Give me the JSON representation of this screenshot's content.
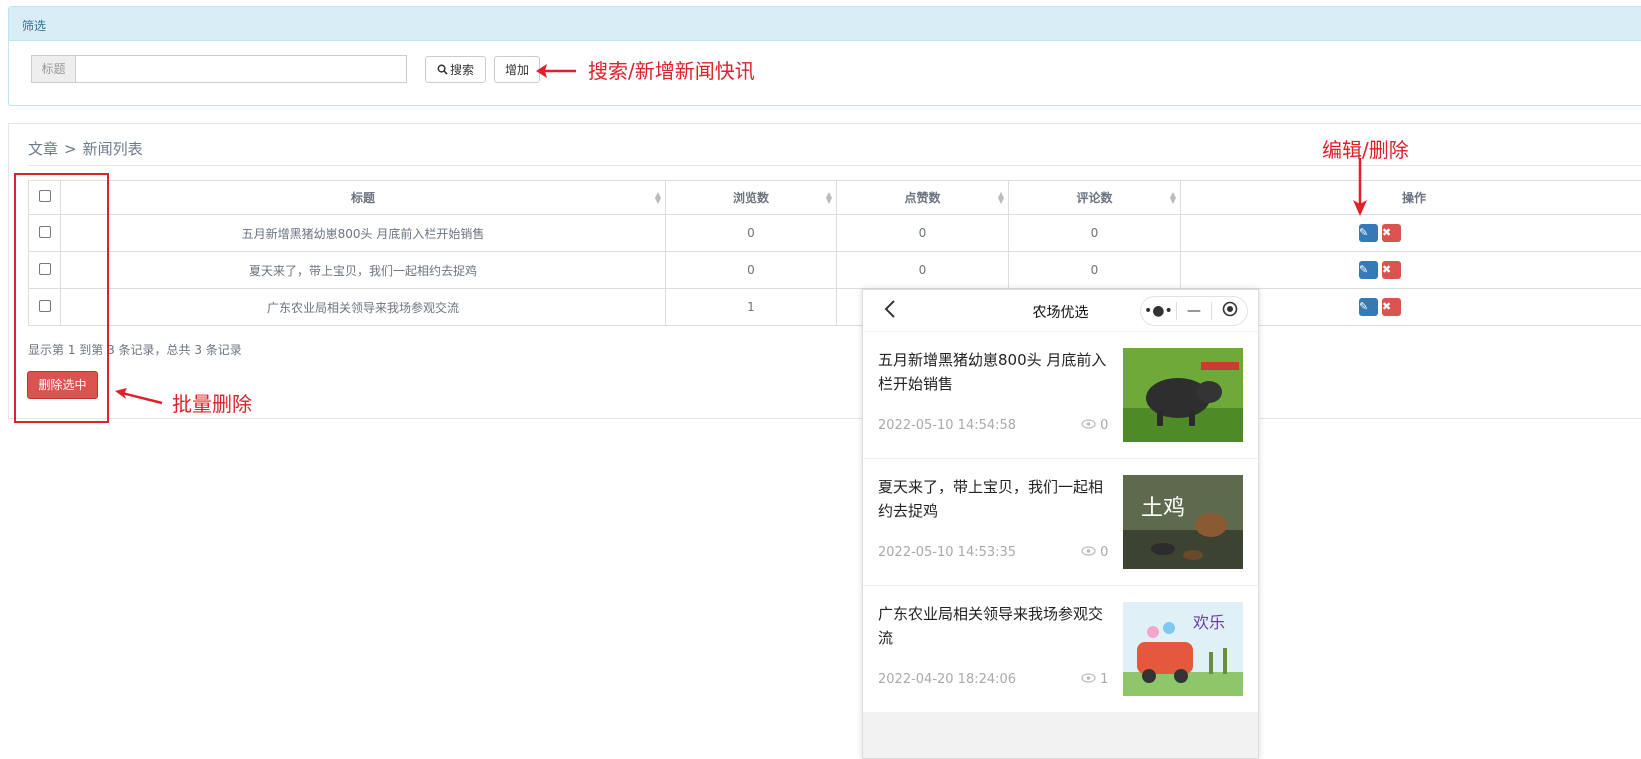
{
  "filter": {
    "header": "筛选",
    "title_label": "标题",
    "search_button": "搜索",
    "add_button": "增加",
    "annotation": "搜索/新增新闻快讯"
  },
  "breadcrumb": {
    "root": "文章",
    "separator": ">",
    "current": "新闻列表"
  },
  "annotations": {
    "edit_delete": "编辑/删除",
    "batch_delete": "批量删除"
  },
  "table": {
    "headers": [
      "标题",
      "浏览数",
      "点赞数",
      "评论数",
      "操作"
    ],
    "rows": [
      {
        "title": "五月新增黑猪幼崽800头 月底前入栏开始销售",
        "views": "0",
        "likes": "0",
        "comments": "0"
      },
      {
        "title": "夏天来了，带上宝贝，我们一起相约去捉鸡",
        "views": "0",
        "likes": "0",
        "comments": "0"
      },
      {
        "title": "广东农业局相关领导来我场参观交流",
        "views": "1",
        "likes": "",
        "comments": ""
      }
    ],
    "footer": "显示第 1 到第 3 条记录，总共 3 条记录",
    "delete_selected": "删除选中"
  },
  "phone": {
    "title": "农场优选",
    "news": [
      {
        "title": "五月新增黑猪幼崽800头 月底前入栏开始销售",
        "date": "2022-05-10 14:54:58",
        "views": "0"
      },
      {
        "title": "夏天来了，带上宝贝，我们一起相约去捉鸡",
        "date": "2022-05-10 14:53:35",
        "views": "0"
      },
      {
        "title": "广东农业局相关领导来我场参观交流",
        "date": "2022-04-20 18:24:06",
        "views": "1"
      }
    ]
  },
  "colors": {
    "annotation_red": "#e0202a",
    "primary": "#337ab7",
    "danger": "#d9534f",
    "info_bg": "#d9edf7"
  },
  "icons": [
    "search-icon",
    "edit-icon",
    "delete-icon",
    "back-icon",
    "more-icon",
    "minimize-icon",
    "close-circle-icon",
    "eye-icon",
    "arrow-icon"
  ]
}
